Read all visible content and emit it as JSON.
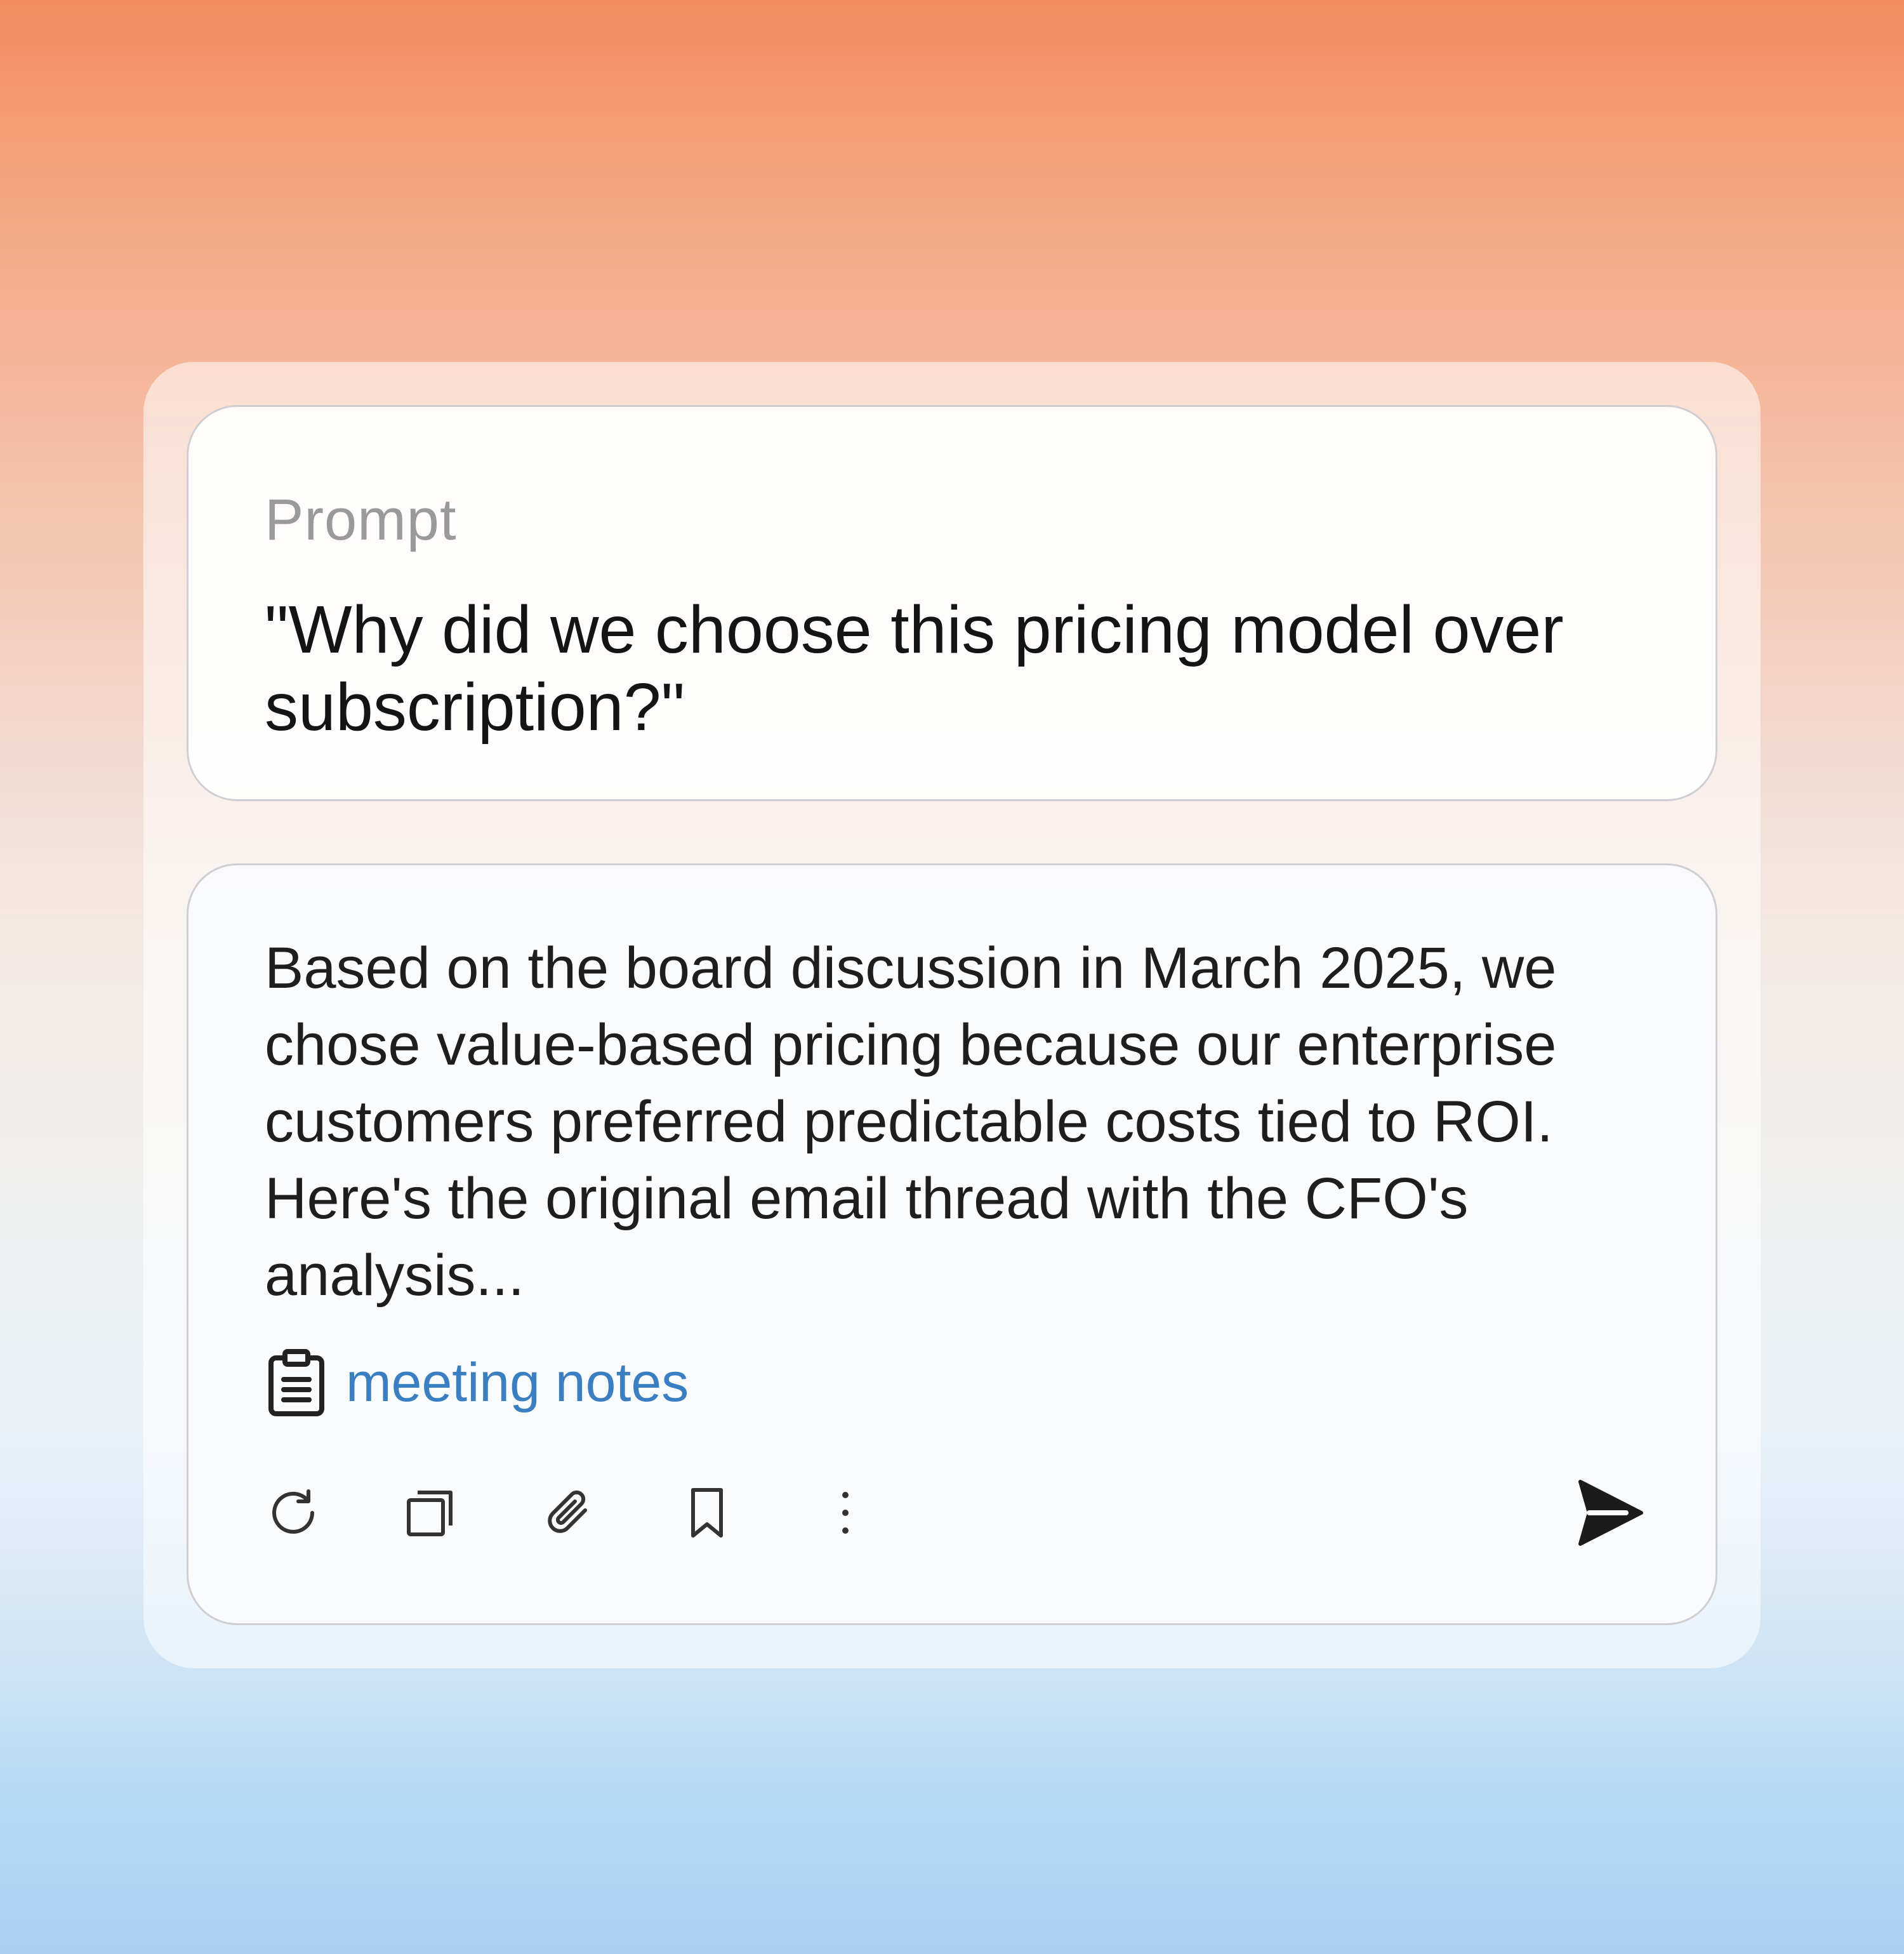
{
  "prompt": {
    "label": "Prompt",
    "text": "\"Why did we choose this pricing model over subscription?\""
  },
  "response": {
    "text": "Based on the board discussion in March 2025, we chose value-based pricing because our enterprise customers preferred predictable costs tied to ROI. Here's the original email thread with the CFO's analysis...",
    "source": {
      "icon": "clipboard-icon",
      "label": "meeting notes"
    },
    "actions": [
      {
        "icon": "refresh-icon"
      },
      {
        "icon": "copy-icon"
      },
      {
        "icon": "paperclip-icon"
      },
      {
        "icon": "bookmark-icon"
      },
      {
        "icon": "more-vertical-icon"
      }
    ],
    "send_icon": "send-icon"
  },
  "colors": {
    "link": "#3a7fc2",
    "text": "#1e1e1e",
    "label": "#9a9a9a"
  }
}
